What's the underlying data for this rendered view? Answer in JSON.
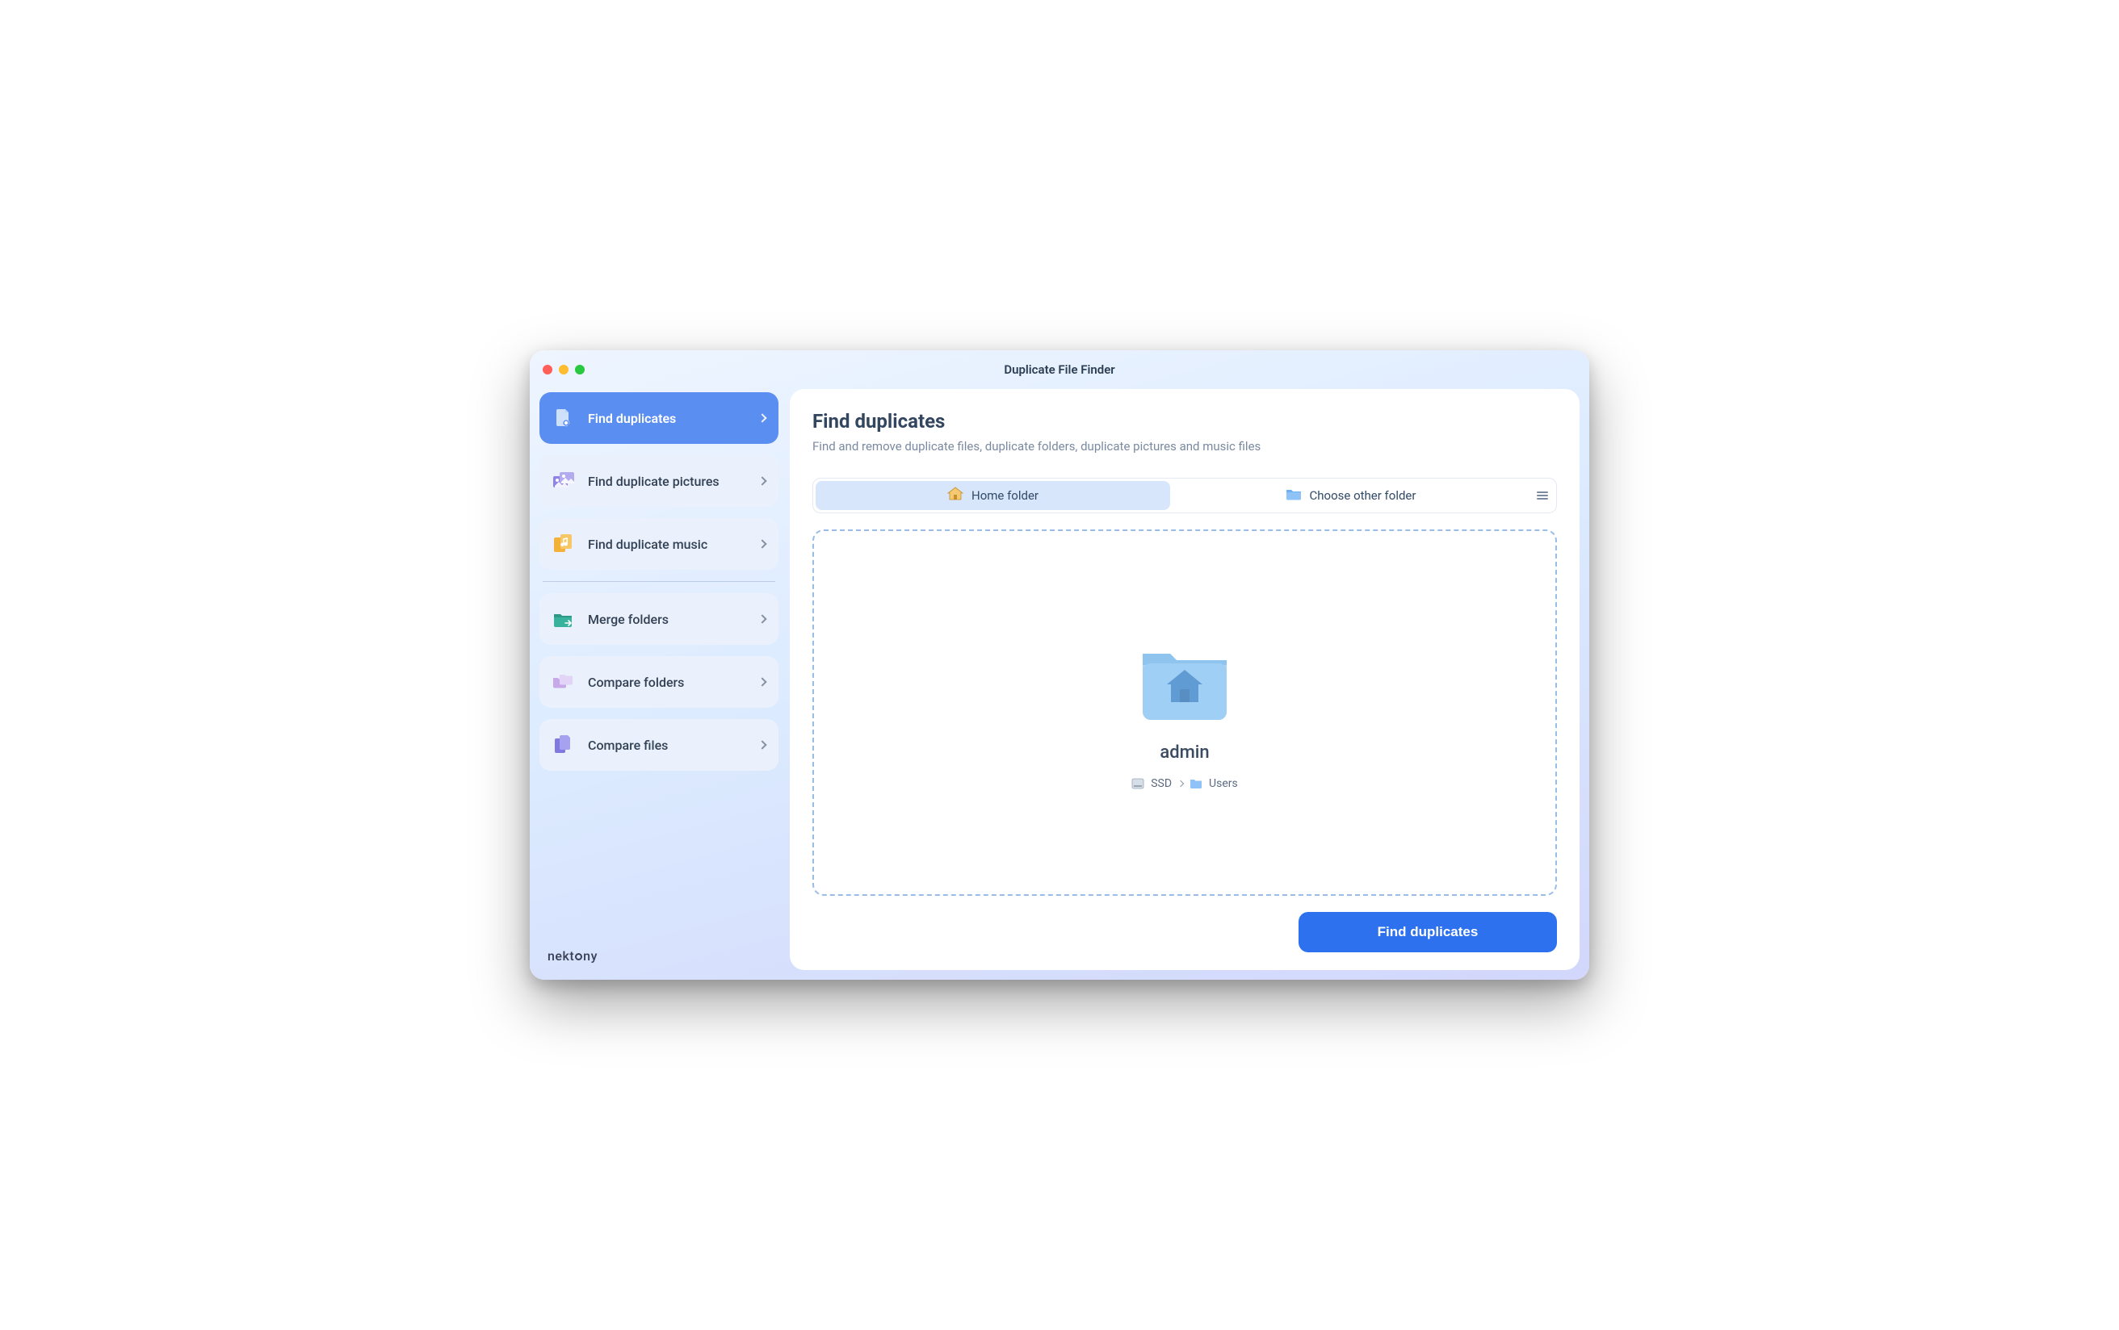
{
  "window": {
    "title": "Duplicate File Finder"
  },
  "brand": {
    "prefix": "nekt",
    "suffix": "ny"
  },
  "sidebar": {
    "group1": [
      {
        "label": "Find duplicates"
      },
      {
        "label": "Find duplicate pictures"
      },
      {
        "label": "Find duplicate music"
      }
    ],
    "group2": [
      {
        "label": "Merge folders"
      },
      {
        "label": "Compare folders"
      },
      {
        "label": "Compare files"
      }
    ]
  },
  "main": {
    "heading": "Find duplicates",
    "subtitle": "Find and remove duplicate files, duplicate folders, duplicate pictures and music files",
    "segmented": {
      "home_label": "Home folder",
      "other_label": "Choose other folder"
    },
    "selected_folder": {
      "name": "admin",
      "path": {
        "disk": "SSD",
        "folder": "Users"
      }
    },
    "primary_button": "Find duplicates"
  }
}
